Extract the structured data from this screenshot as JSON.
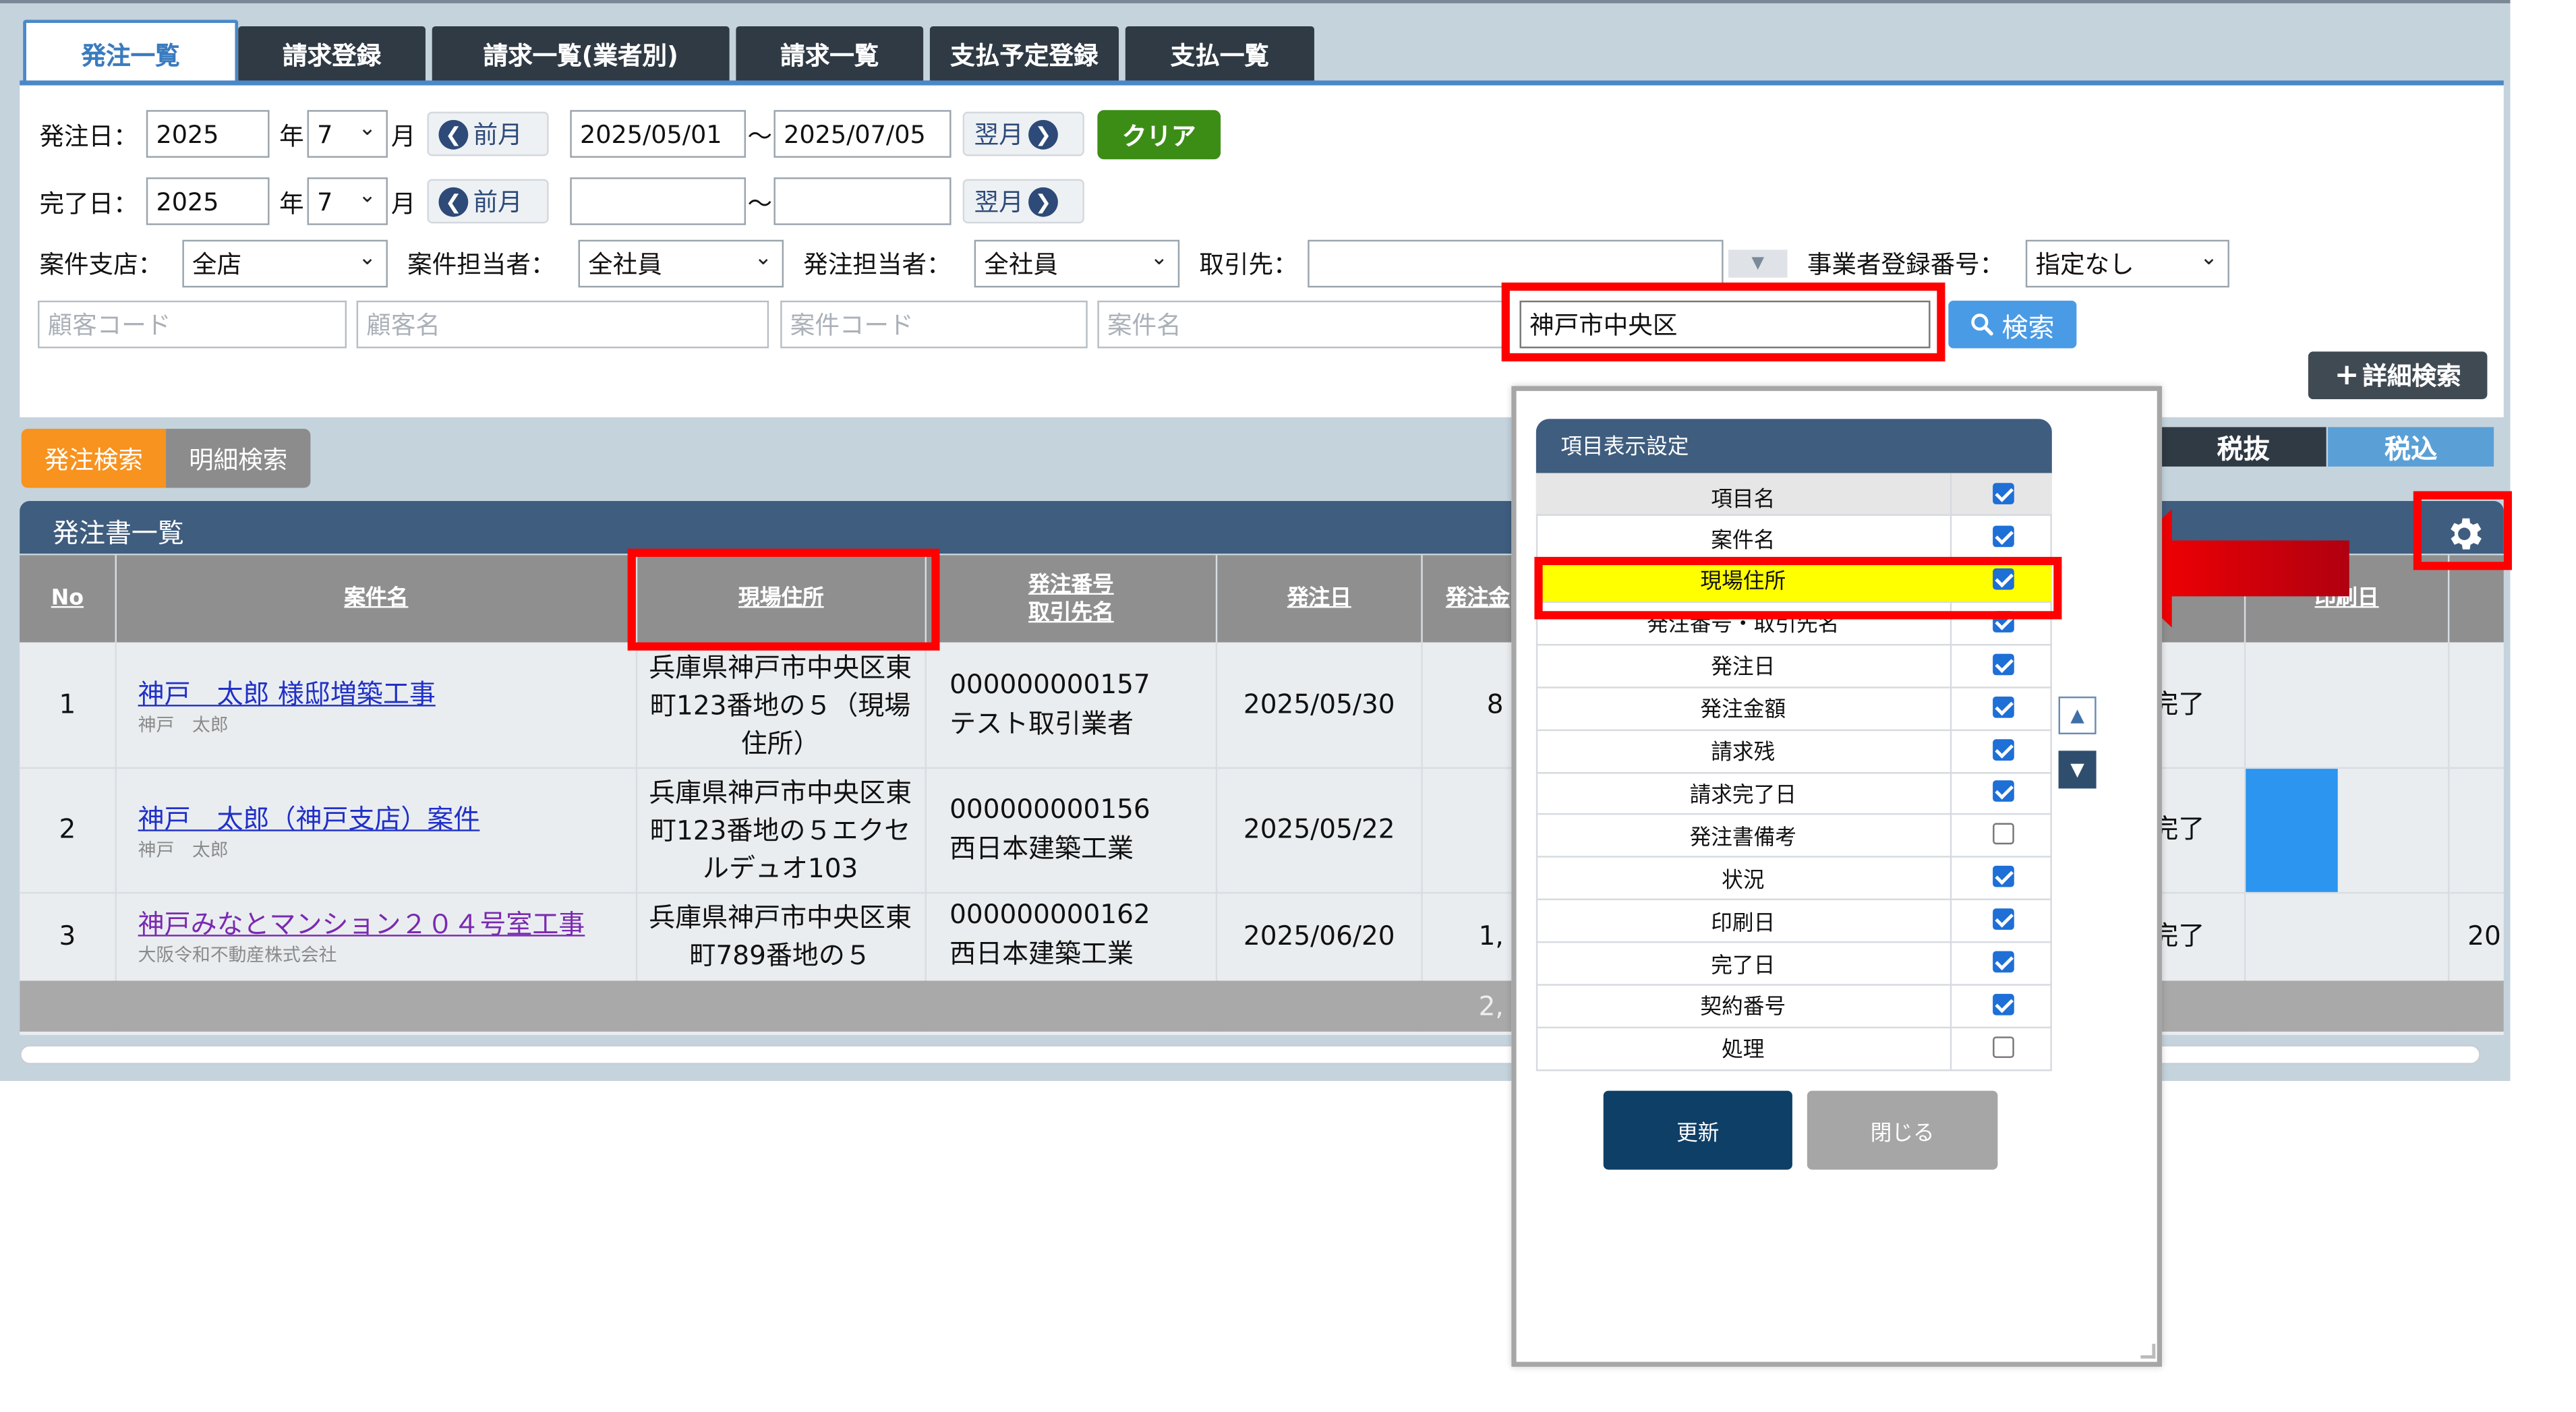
{
  "tabs": [
    {
      "label": "発注一覧",
      "active": true
    },
    {
      "label": "請求登録",
      "active": false
    },
    {
      "label": "請求一覧(業者別)",
      "active": false
    },
    {
      "label": "請求一覧",
      "active": false
    },
    {
      "label": "支払予定登録",
      "active": false
    },
    {
      "label": "支払一覧",
      "active": false
    }
  ],
  "filters": {
    "order_date_label": "発注日：",
    "order_year": "2025",
    "year_suffix": "年",
    "order_month": "7",
    "month_suffix": "月",
    "prev_label": "前月",
    "next_label": "翌月",
    "order_from": "2025/05/01",
    "tilde": "～",
    "order_to": "2025/07/05",
    "clear_label": "クリア",
    "done_date_label": "完了日：",
    "done_year": "2025",
    "done_month": "7",
    "done_from": "",
    "done_to": "",
    "branch_label": "案件支店：",
    "branch_value": "全店",
    "case_staff_label": "案件担当者：",
    "case_staff_value": "全社員",
    "order_staff_label": "発注担当者：",
    "order_staff_value": "全社員",
    "partner_label": "取引先：",
    "partner_value": "",
    "regno_label": "事業者登録番号：",
    "regno_value": "指定なし",
    "customer_code_ph": "顧客コード",
    "customer_name_ph": "顧客名",
    "case_code_ph": "案件コード",
    "case_name_ph": "案件名",
    "address_value": "神戸市中央区",
    "search_label": "検索",
    "detail_search_label": "詳細検索"
  },
  "subtabs": {
    "order_search": "発注検索",
    "detail_search": "明細検索"
  },
  "tax": {
    "excl": "税抜",
    "incl": "税込"
  },
  "list": {
    "title": "発注書一覧",
    "columns": {
      "no": "No",
      "case": "案件名",
      "site": "現場住所",
      "order_no_1": "発注番号",
      "order_no_2": "取引先名",
      "date": "発注日",
      "amount": "発注金",
      "print_date": "印刷日"
    },
    "rows": [
      {
        "no": "1",
        "case": "神戸　太郎 様邸増築工事",
        "case_sub": "神戸　太郎",
        "site": "兵庫県神戸市中央区東町123番地の５（現場住所）",
        "order_no": "000000000157",
        "partner": "テスト取引業者",
        "date": "2025/05/30",
        "amount": "8",
        "status": "完了",
        "extra": ""
      },
      {
        "no": "2",
        "case": "神戸　太郎（神戸支店）案件",
        "case_sub": "神戸　太郎",
        "site": "兵庫県神戸市中央区東町123番地の５エクセルデュオ103",
        "order_no": "000000000156",
        "partner": "西日本建築工業",
        "date": "2025/05/22",
        "amount": "",
        "status": "完了",
        "extra": ""
      },
      {
        "no": "3",
        "case": "神戸みなとマンション２０４号室工事",
        "case_sub": "大阪令和不動産株式会社",
        "site": "兵庫県神戸市中央区東町789番地の５",
        "order_no": "000000000162",
        "partner": "西日本建築工業",
        "date": "2025/06/20",
        "amount": "1,",
        "status": "完了",
        "extra": "20"
      }
    ],
    "total": "2,"
  },
  "modal": {
    "title": "項目表示設定",
    "header": "項目名",
    "items": [
      {
        "label": "案件名",
        "checked": true
      },
      {
        "label": "現場住所",
        "checked": true
      },
      {
        "label": "発注番号・取引先名",
        "checked": true
      },
      {
        "label": "発注日",
        "checked": true
      },
      {
        "label": "発注金額",
        "checked": true
      },
      {
        "label": "請求残",
        "checked": true
      },
      {
        "label": "請求完了日",
        "checked": true
      },
      {
        "label": "発注書備考",
        "checked": false
      },
      {
        "label": "状況",
        "checked": true
      },
      {
        "label": "印刷日",
        "checked": true
      },
      {
        "label": "完了日",
        "checked": true
      },
      {
        "label": "契約番号",
        "checked": true
      },
      {
        "label": "処理",
        "checked": false
      }
    ],
    "update_label": "更新",
    "close_label": "閉じる"
  },
  "colors": {
    "highlight": "#ffff00",
    "annotation": "#ff0000",
    "accent": "#1e6fd6",
    "panel_header": "#3f5d7e",
    "orange": "#f7931e",
    "green": "#3c8d16"
  }
}
